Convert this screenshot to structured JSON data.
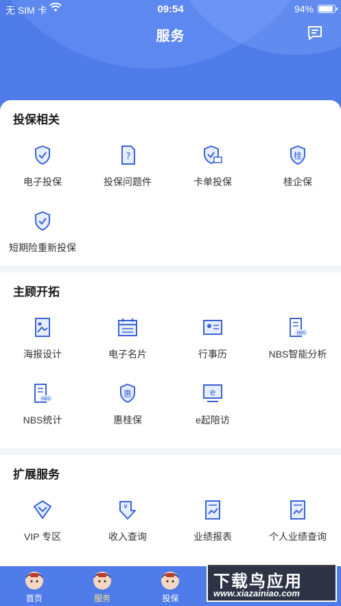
{
  "status_bar": {
    "carrier": "无 SIM 卡",
    "time": "09:54",
    "battery": "94%",
    "battery_level": 0.94
  },
  "header": {
    "title": "服务"
  },
  "colors": {
    "primary": "#4f7ce8",
    "icon_blue": "#3a62d6",
    "tab_active": "#ffe08a"
  },
  "sections": [
    {
      "title": "投保相关",
      "items": [
        {
          "label": "电子投保",
          "icon": "shield-check-icon"
        },
        {
          "label": "投保问题件",
          "icon": "document-question-icon"
        },
        {
          "label": "卡单投保",
          "icon": "shield-card-icon"
        },
        {
          "label": "桂企保",
          "icon": "shield-gui-icon"
        },
        {
          "label": "短期险重新投保",
          "icon": "shield-check-icon"
        }
      ]
    },
    {
      "title": "主顾开拓",
      "items": [
        {
          "label": "海报设计",
          "icon": "poster-icon"
        },
        {
          "label": "电子名片",
          "icon": "calendar-card-icon"
        },
        {
          "label": "行事历",
          "icon": "id-card-icon"
        },
        {
          "label": "NBS智能分析",
          "icon": "nbs-document-icon"
        },
        {
          "label": "NBS统计",
          "icon": "nbs-document-icon"
        },
        {
          "label": "惠桂保",
          "icon": "shield-hui-icon"
        },
        {
          "label": "e起陪访",
          "icon": "e-monitor-icon"
        }
      ]
    },
    {
      "title": "扩展服务",
      "items": [
        {
          "label": "VIP 专区",
          "icon": "vip-diamond-icon"
        },
        {
          "label": "收入查询",
          "icon": "income-icon"
        },
        {
          "label": "业绩报表",
          "icon": "report-icon"
        },
        {
          "label": "个人业绩查询",
          "icon": "personal-report-icon"
        }
      ]
    }
  ],
  "tabbar": [
    {
      "label": "首页",
      "active": false
    },
    {
      "label": "服务",
      "active": true
    },
    {
      "label": "投保",
      "active": false
    },
    {
      "label": "",
      "active": false
    },
    {
      "label": "",
      "active": false
    }
  ],
  "watermark": {
    "main": "下载鸟应用",
    "url": "www.xiazainiao.com"
  }
}
